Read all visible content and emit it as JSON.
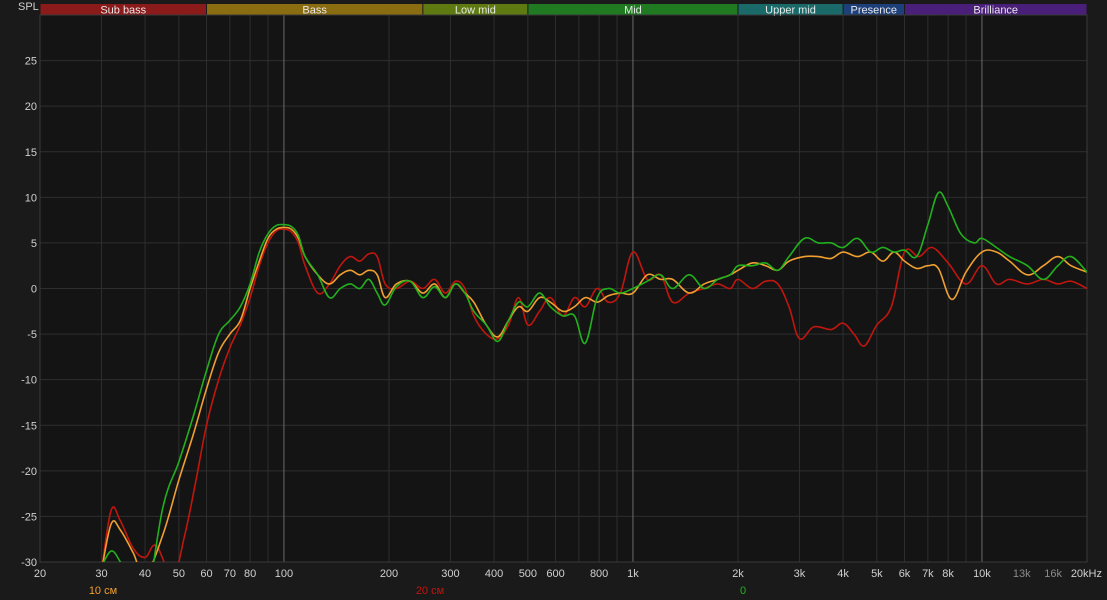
{
  "chart_data": {
    "type": "line",
    "ylabel": "SPL",
    "xunit": "kHz",
    "x_scale": "log",
    "xlim": [
      20,
      20000
    ],
    "ylim": [
      -30,
      30
    ],
    "grid": true,
    "y_ticks": [
      -30,
      -25,
      -20,
      -15,
      -10,
      -5,
      0,
      5,
      10,
      15,
      20,
      25
    ],
    "x_ticks": [
      {
        "value": 20,
        "label": "20"
      },
      {
        "value": 30,
        "label": "30"
      },
      {
        "value": 40,
        "label": "40"
      },
      {
        "value": 50,
        "label": "50"
      },
      {
        "value": 60,
        "label": "60"
      },
      {
        "value": 70,
        "label": "70"
      },
      {
        "value": 80,
        "label": "80"
      },
      {
        "value": 100,
        "label": "100"
      },
      {
        "value": 200,
        "label": "200"
      },
      {
        "value": 300,
        "label": "300"
      },
      {
        "value": 400,
        "label": "400"
      },
      {
        "value": 500,
        "label": "500"
      },
      {
        "value": 600,
        "label": "600"
      },
      {
        "value": 800,
        "label": "800"
      },
      {
        "value": 1000,
        "label": "1k"
      },
      {
        "value": 2000,
        "label": "2k"
      },
      {
        "value": 3000,
        "label": "3k"
      },
      {
        "value": 4000,
        "label": "4k"
      },
      {
        "value": 5000,
        "label": "5k"
      },
      {
        "value": 6000,
        "label": "6k"
      },
      {
        "value": 7000,
        "label": "7k"
      },
      {
        "value": 8000,
        "label": "8k"
      },
      {
        "value": 10000,
        "label": "10k"
      },
      {
        "value": 13000,
        "label": "13k",
        "dim": true
      },
      {
        "value": 16000,
        "label": "16k",
        "dim": true
      },
      {
        "value": 20000,
        "label": "20kHz"
      }
    ],
    "bands": [
      {
        "label": "Sub bass",
        "from": 20,
        "to": 60,
        "color": "#8b1a1a"
      },
      {
        "label": "Bass",
        "from": 60,
        "to": 250,
        "color": "#8a6d10"
      },
      {
        "label": "Low mid",
        "from": 250,
        "to": 500,
        "color": "#5e7a10"
      },
      {
        "label": "Mid",
        "from": 500,
        "to": 2000,
        "color": "#1f7a22"
      },
      {
        "label": "Upper mid",
        "from": 2000,
        "to": 4000,
        "color": "#1a6a6a"
      },
      {
        "label": "Presence",
        "from": 4000,
        "to": 6000,
        "color": "#1d3f7a"
      },
      {
        "label": "Brilliance",
        "from": 6000,
        "to": 20000,
        "color": "#4a1f7a"
      }
    ],
    "series": [
      {
        "name": "10 см",
        "color": "#f0a030",
        "points": [
          [
            30,
            -31
          ],
          [
            32,
            -25.8
          ],
          [
            34,
            -26.5
          ],
          [
            37,
            -29
          ],
          [
            40,
            -31.5
          ],
          [
            45,
            -27
          ],
          [
            50,
            -21
          ],
          [
            55,
            -16
          ],
          [
            60,
            -11
          ],
          [
            65,
            -7
          ],
          [
            70,
            -5
          ],
          [
            75,
            -3.5
          ],
          [
            80,
            0
          ],
          [
            85,
            3
          ],
          [
            90,
            5.5
          ],
          [
            95,
            6.5
          ],
          [
            100,
            6.7
          ],
          [
            105,
            6.5
          ],
          [
            110,
            5.5
          ],
          [
            115,
            3.5
          ],
          [
            125,
            1.5
          ],
          [
            135,
            0.5
          ],
          [
            145,
            1.5
          ],
          [
            155,
            2
          ],
          [
            165,
            1.5
          ],
          [
            175,
            2
          ],
          [
            185,
            1.5
          ],
          [
            195,
            -1
          ],
          [
            210,
            0.5
          ],
          [
            230,
            0.8
          ],
          [
            250,
            -0.5
          ],
          [
            270,
            0.5
          ],
          [
            290,
            -1
          ],
          [
            310,
            0.5
          ],
          [
            330,
            -0.5
          ],
          [
            350,
            -1.5
          ],
          [
            380,
            -4
          ],
          [
            410,
            -5.3
          ],
          [
            440,
            -3.5
          ],
          [
            470,
            -2
          ],
          [
            500,
            -2.5
          ],
          [
            540,
            -1
          ],
          [
            580,
            -1.5
          ],
          [
            630,
            -2.5
          ],
          [
            680,
            -2
          ],
          [
            730,
            -1
          ],
          [
            790,
            -1.5
          ],
          [
            850,
            -0.8
          ],
          [
            920,
            -0.5
          ],
          [
            1000,
            -0.5
          ],
          [
            1100,
            1.5
          ],
          [
            1200,
            1
          ],
          [
            1300,
            1
          ],
          [
            1450,
            -0.5
          ],
          [
            1600,
            0.5
          ],
          [
            1750,
            1
          ],
          [
            1900,
            1.5
          ],
          [
            2000,
            2
          ],
          [
            2200,
            2.8
          ],
          [
            2400,
            2.5
          ],
          [
            2600,
            2
          ],
          [
            2800,
            3
          ],
          [
            3100,
            3.5
          ],
          [
            3400,
            3.5
          ],
          [
            3700,
            3.3
          ],
          [
            4000,
            4
          ],
          [
            4400,
            3.5
          ],
          [
            4800,
            4
          ],
          [
            5200,
            3
          ],
          [
            5600,
            4
          ],
          [
            6000,
            3
          ],
          [
            6500,
            2.2
          ],
          [
            7000,
            2.5
          ],
          [
            7500,
            2.2
          ],
          [
            8200,
            -1.2
          ],
          [
            9000,
            1.8
          ],
          [
            10000,
            4
          ],
          [
            11000,
            4
          ],
          [
            12000,
            3
          ],
          [
            13500,
            1.5
          ],
          [
            15000,
            2.5
          ],
          [
            16500,
            3.5
          ],
          [
            18000,
            2.5
          ],
          [
            20000,
            1.8
          ]
        ]
      },
      {
        "name": "20 см",
        "color": "#c0160e",
        "points": [
          [
            30,
            -31
          ],
          [
            32,
            -24.3
          ],
          [
            34,
            -25.5
          ],
          [
            37,
            -28.5
          ],
          [
            40,
            -29.5
          ],
          [
            43,
            -28.2
          ],
          [
            48,
            -31.5
          ],
          [
            52,
            -27
          ],
          [
            56,
            -21
          ],
          [
            60,
            -15
          ],
          [
            65,
            -10
          ],
          [
            70,
            -6.5
          ],
          [
            75,
            -4
          ],
          [
            80,
            -1
          ],
          [
            85,
            2.5
          ],
          [
            90,
            5
          ],
          [
            95,
            6.3
          ],
          [
            100,
            6.5
          ],
          [
            105,
            6.2
          ],
          [
            110,
            5
          ],
          [
            115,
            2.5
          ],
          [
            125,
            -0.5
          ],
          [
            135,
            0.5
          ],
          [
            145,
            2.5
          ],
          [
            155,
            3.5
          ],
          [
            165,
            3
          ],
          [
            175,
            3.8
          ],
          [
            185,
            3.5
          ],
          [
            195,
            0.5
          ],
          [
            210,
            0
          ],
          [
            230,
            0.8
          ],
          [
            250,
            0
          ],
          [
            270,
            1
          ],
          [
            290,
            -0.5
          ],
          [
            310,
            0.8
          ],
          [
            330,
            0
          ],
          [
            350,
            -3
          ],
          [
            380,
            -5
          ],
          [
            410,
            -5.5
          ],
          [
            440,
            -4
          ],
          [
            470,
            -1
          ],
          [
            500,
            -4
          ],
          [
            540,
            -2.5
          ],
          [
            580,
            -1
          ],
          [
            630,
            -3
          ],
          [
            680,
            -1
          ],
          [
            730,
            -2
          ],
          [
            790,
            0
          ],
          [
            850,
            -1.5
          ],
          [
            920,
            -0.5
          ],
          [
            1000,
            4
          ],
          [
            1100,
            1
          ],
          [
            1200,
            1.5
          ],
          [
            1300,
            -1.5
          ],
          [
            1450,
            -0.5
          ],
          [
            1600,
            0
          ],
          [
            1750,
            0.5
          ],
          [
            1900,
            0
          ],
          [
            2000,
            1
          ],
          [
            2200,
            0
          ],
          [
            2400,
            0.8
          ],
          [
            2600,
            0.5
          ],
          [
            2800,
            -2
          ],
          [
            3000,
            -5.5
          ],
          [
            3300,
            -4.2
          ],
          [
            3700,
            -4.5
          ],
          [
            4000,
            -3.8
          ],
          [
            4300,
            -5
          ],
          [
            4600,
            -6.3
          ],
          [
            5000,
            -4
          ],
          [
            5500,
            -2
          ],
          [
            6000,
            4
          ],
          [
            6600,
            3.5
          ],
          [
            7200,
            4.5
          ],
          [
            8000,
            2.8
          ],
          [
            9000,
            0.5
          ],
          [
            10000,
            2.5
          ],
          [
            11000,
            0.5
          ],
          [
            12000,
            1
          ],
          [
            13500,
            0.5
          ],
          [
            15000,
            1
          ],
          [
            16500,
            0.5
          ],
          [
            18000,
            0.8
          ],
          [
            20000,
            0
          ]
        ]
      },
      {
        "name": "0",
        "color": "#22b11d",
        "points": [
          [
            30,
            -30.5
          ],
          [
            32,
            -28.8
          ],
          [
            34,
            -30
          ],
          [
            37,
            -32.5
          ],
          [
            40,
            -35
          ],
          [
            45,
            -24
          ],
          [
            50,
            -19
          ],
          [
            55,
            -14
          ],
          [
            60,
            -9
          ],
          [
            65,
            -5
          ],
          [
            70,
            -3.5
          ],
          [
            75,
            -2
          ],
          [
            80,
            0.5
          ],
          [
            85,
            4
          ],
          [
            90,
            6
          ],
          [
            95,
            6.9
          ],
          [
            100,
            7
          ],
          [
            105,
            6.8
          ],
          [
            110,
            5.8
          ],
          [
            115,
            3.5
          ],
          [
            125,
            1.5
          ],
          [
            135,
            -1
          ],
          [
            145,
            0
          ],
          [
            155,
            0.5
          ],
          [
            165,
            0
          ],
          [
            175,
            1
          ],
          [
            185,
            -0.5
          ],
          [
            195,
            -1.8
          ],
          [
            210,
            0.2
          ],
          [
            230,
            0.8
          ],
          [
            250,
            -1
          ],
          [
            270,
            0.2
          ],
          [
            290,
            -1
          ],
          [
            310,
            0.5
          ],
          [
            330,
            -0.5
          ],
          [
            350,
            -2.5
          ],
          [
            380,
            -4
          ],
          [
            410,
            -5.8
          ],
          [
            440,
            -3.5
          ],
          [
            470,
            -1.5
          ],
          [
            500,
            -2
          ],
          [
            540,
            -0.5
          ],
          [
            580,
            -2
          ],
          [
            630,
            -3
          ],
          [
            680,
            -3
          ],
          [
            730,
            -6
          ],
          [
            790,
            -1
          ],
          [
            850,
            0
          ],
          [
            920,
            -0.5
          ],
          [
            1000,
            0
          ],
          [
            1100,
            0.8
          ],
          [
            1200,
            1.5
          ],
          [
            1300,
            0
          ],
          [
            1450,
            1.5
          ],
          [
            1600,
            0
          ],
          [
            1750,
            1
          ],
          [
            1900,
            1.5
          ],
          [
            2000,
            2.5
          ],
          [
            2200,
            2.5
          ],
          [
            2400,
            2.8
          ],
          [
            2600,
            2
          ],
          [
            2800,
            3.5
          ],
          [
            3100,
            5.5
          ],
          [
            3400,
            5
          ],
          [
            3700,
            5
          ],
          [
            4000,
            4.5
          ],
          [
            4400,
            5.5
          ],
          [
            4800,
            4
          ],
          [
            5200,
            4.5
          ],
          [
            5600,
            4
          ],
          [
            6000,
            4.2
          ],
          [
            6500,
            3.5
          ],
          [
            7000,
            7
          ],
          [
            7500,
            10.5
          ],
          [
            8000,
            9
          ],
          [
            8700,
            6
          ],
          [
            9500,
            5
          ],
          [
            10000,
            5.5
          ],
          [
            11000,
            4.5
          ],
          [
            12000,
            3.5
          ],
          [
            13500,
            2.5
          ],
          [
            15000,
            1
          ],
          [
            16500,
            2.5
          ],
          [
            18000,
            3.5
          ],
          [
            20000,
            1.8
          ]
        ]
      }
    ]
  }
}
